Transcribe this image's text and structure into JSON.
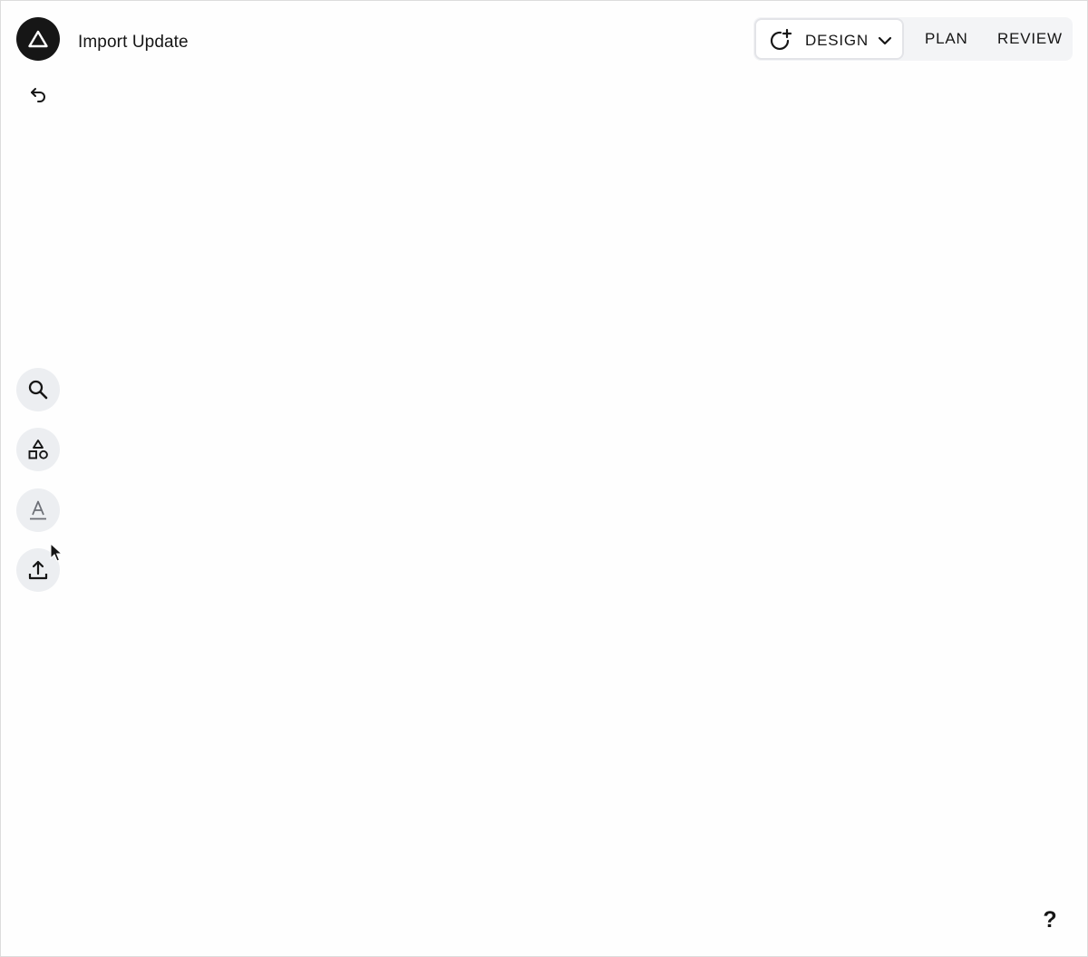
{
  "header": {
    "doc_title": "Import Update",
    "logo_icon": "triangle-logo-icon",
    "undo_icon": "undo-icon"
  },
  "mode_switch": {
    "design_label": "DESIGN",
    "design_icon": "refresh-add-icon",
    "plan_label": "PLAN",
    "review_label": "REVIEW",
    "active": "DESIGN"
  },
  "toolbar": {
    "items": [
      {
        "icon": "search-icon"
      },
      {
        "icon": "shapes-icon"
      },
      {
        "icon": "text-icon"
      },
      {
        "icon": "upload-icon"
      }
    ]
  },
  "help": {
    "label": "?"
  },
  "colors": {
    "logo_bg": "#161616",
    "tool_bg": "#eceef1",
    "switch_bg": "#f3f4f6"
  }
}
